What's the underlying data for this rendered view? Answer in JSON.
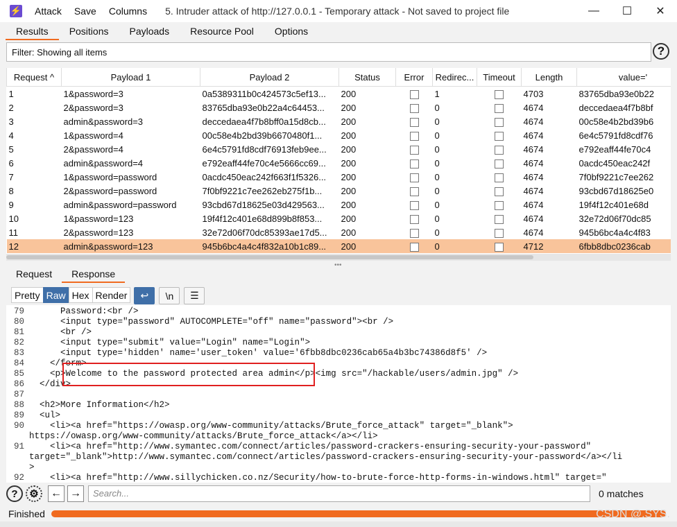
{
  "titlebar": {
    "menu": [
      "Attack",
      "Save",
      "Columns"
    ],
    "title": "5. Intruder attack of http://127.0.0.1 - Temporary attack - Not saved to project file"
  },
  "tabs": [
    "Results",
    "Positions",
    "Payloads",
    "Resource Pool",
    "Options"
  ],
  "filter": "Filter: Showing all items",
  "table": {
    "headers": [
      "Request",
      "Payload 1",
      "Payload 2",
      "Status",
      "Error",
      "Redirec...",
      "Timeout",
      "Length",
      "value='"
    ],
    "rows": [
      [
        "1",
        "1&password=3",
        "0a5389311b0c424573c5ef13...",
        "200",
        "",
        "1",
        "",
        "4703",
        "83765dba93e0b22"
      ],
      [
        "2",
        "2&password=3",
        "83765dba93e0b22a4c64453...",
        "200",
        "",
        "0",
        "",
        "4674",
        "deccedaea4f7b8bf"
      ],
      [
        "3",
        "admin&password=3",
        "deccedaea4f7b8bff0a15d8cb...",
        "200",
        "",
        "0",
        "",
        "4674",
        "00c58e4b2bd39b6"
      ],
      [
        "4",
        "1&password=4",
        "00c58e4b2bd39b6670480f1...",
        "200",
        "",
        "0",
        "",
        "4674",
        "6e4c5791fd8cdf76"
      ],
      [
        "5",
        "2&password=4",
        "6e4c5791fd8cdf76913feb9ee...",
        "200",
        "",
        "0",
        "",
        "4674",
        "e792eaff44fe70c4"
      ],
      [
        "6",
        "admin&password=4",
        "e792eaff44fe70c4e5666cc69...",
        "200",
        "",
        "0",
        "",
        "4674",
        "0acdc450eac242f"
      ],
      [
        "7",
        "1&password=password",
        "0acdc450eac242f663f1f5326...",
        "200",
        "",
        "0",
        "",
        "4674",
        "7f0bf9221c7ee262"
      ],
      [
        "8",
        "2&password=password",
        "7f0bf9221c7ee262eb275f1b...",
        "200",
        "",
        "0",
        "",
        "4674",
        "93cbd67d18625e0"
      ],
      [
        "9",
        "admin&password=password",
        "93cbd67d18625e03d429563...",
        "200",
        "",
        "0",
        "",
        "4674",
        "19f4f12c401e68d"
      ],
      [
        "10",
        "1&password=123",
        "19f4f12c401e68d899b8f853...",
        "200",
        "",
        "0",
        "",
        "4674",
        "32e72d06f70dc85"
      ],
      [
        "11",
        "2&password=123",
        "32e72d06f70dc85393ae17d5...",
        "200",
        "",
        "0",
        "",
        "4674",
        "945b6bc4a4c4f83"
      ],
      [
        "12",
        "admin&password=123",
        "945b6bc4a4c4f832a10b1c89...",
        "200",
        "",
        "0",
        "",
        "4712",
        "6fbb8dbc0236cab"
      ]
    ]
  },
  "response_tabs": [
    "Request",
    "Response"
  ],
  "view_tabs": [
    "Pretty",
    "Raw",
    "Hex",
    "Render"
  ],
  "newline_label": "\\n",
  "code_lines": [
    {
      "n": "79",
      "t": "      Password:<br />"
    },
    {
      "n": "80",
      "t": "      <input type=\"password\" AUTOCOMPLETE=\"off\" name=\"password\"><br />"
    },
    {
      "n": "81",
      "t": "      <br />"
    },
    {
      "n": "82",
      "t": "      <input type=\"submit\" value=\"Login\" name=\"Login\">"
    },
    {
      "n": "83",
      "t": "      <input type='hidden' name='user_token' value='6fbb8dbc0236cab65a4b3bc74386d8f5' />"
    },
    {
      "n": "84",
      "t": "    </form>"
    },
    {
      "n": "85",
      "t": "    <p>Welcome to the password protected area admin</p><img src=\"/hackable/users/admin.jpg\" />"
    },
    {
      "n": "86",
      "t": "  </div>"
    },
    {
      "n": "87",
      "t": ""
    },
    {
      "n": "88",
      "t": "  <h2>More Information</h2>"
    },
    {
      "n": "89",
      "t": "  <ul>"
    },
    {
      "n": "90",
      "t": "    <li><a href=\"https://owasp.org/www-community/attacks/Brute_force_attack\" target=\"_blank\">"
    },
    {
      "n": "",
      "t": "https://owasp.org/www-community/attacks/Brute_force_attack</a></li>"
    },
    {
      "n": "91",
      "t": "    <li><a href=\"http://www.symantec.com/connect/articles/password-crackers-ensuring-security-your-password\""
    },
    {
      "n": "",
      "t": "target=\"_blank\">http://www.symantec.com/connect/articles/password-crackers-ensuring-security-your-password</a></li"
    },
    {
      "n": "",
      "t": ">"
    },
    {
      "n": "92",
      "t": "    <li><a href=\"http://www.sillychicken.co.nz/Security/how-to-brute-force-http-forms-in-windows.html\" target=\""
    }
  ],
  "search": {
    "placeholder": "Search..."
  },
  "matches": "0 matches",
  "status": "Finished",
  "watermark": "CSDN @.SYS.",
  "progress_fraction": 1.0,
  "colors": {
    "accent": "#f06a1f",
    "selected_row": "#f9c49b",
    "active_tab": "#3f6fa8",
    "highlight_box": "#e02020"
  }
}
